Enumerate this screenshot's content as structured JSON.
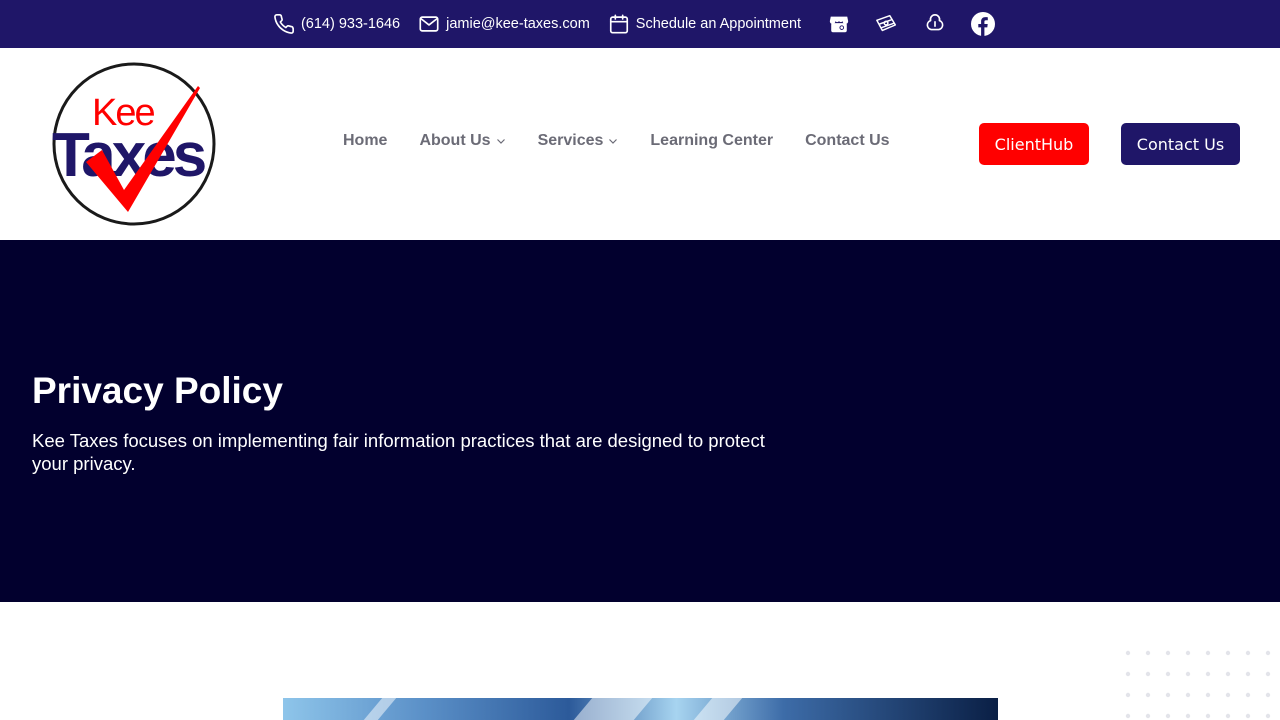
{
  "topbar": {
    "phone": "(614) 933-1646",
    "email": "jamie@kee-taxes.com",
    "appointment": "Schedule an Appointment",
    "social_icons": [
      "store-icon",
      "money-icon",
      "cloud-icon",
      "facebook-icon"
    ]
  },
  "logo": {
    "line1": "Kee",
    "line2": "Taxes"
  },
  "nav": {
    "items": [
      {
        "label": "Home",
        "has_dropdown": false
      },
      {
        "label": "About Us",
        "has_dropdown": true
      },
      {
        "label": "Services",
        "has_dropdown": true
      },
      {
        "label": "Learning Center",
        "has_dropdown": false
      },
      {
        "label": "Contact Us",
        "has_dropdown": false
      }
    ]
  },
  "buttons": {
    "clienthub": "ClientHub",
    "contact": "Contact Us"
  },
  "hero": {
    "title": "Privacy Policy",
    "subtitle": "Kee Taxes focuses on implementing fair information practices that are designed to protect your privacy."
  },
  "colors": {
    "brand_navy": "#1f1668",
    "hero_bg": "#02002e",
    "accent_red": "#ff0000"
  }
}
